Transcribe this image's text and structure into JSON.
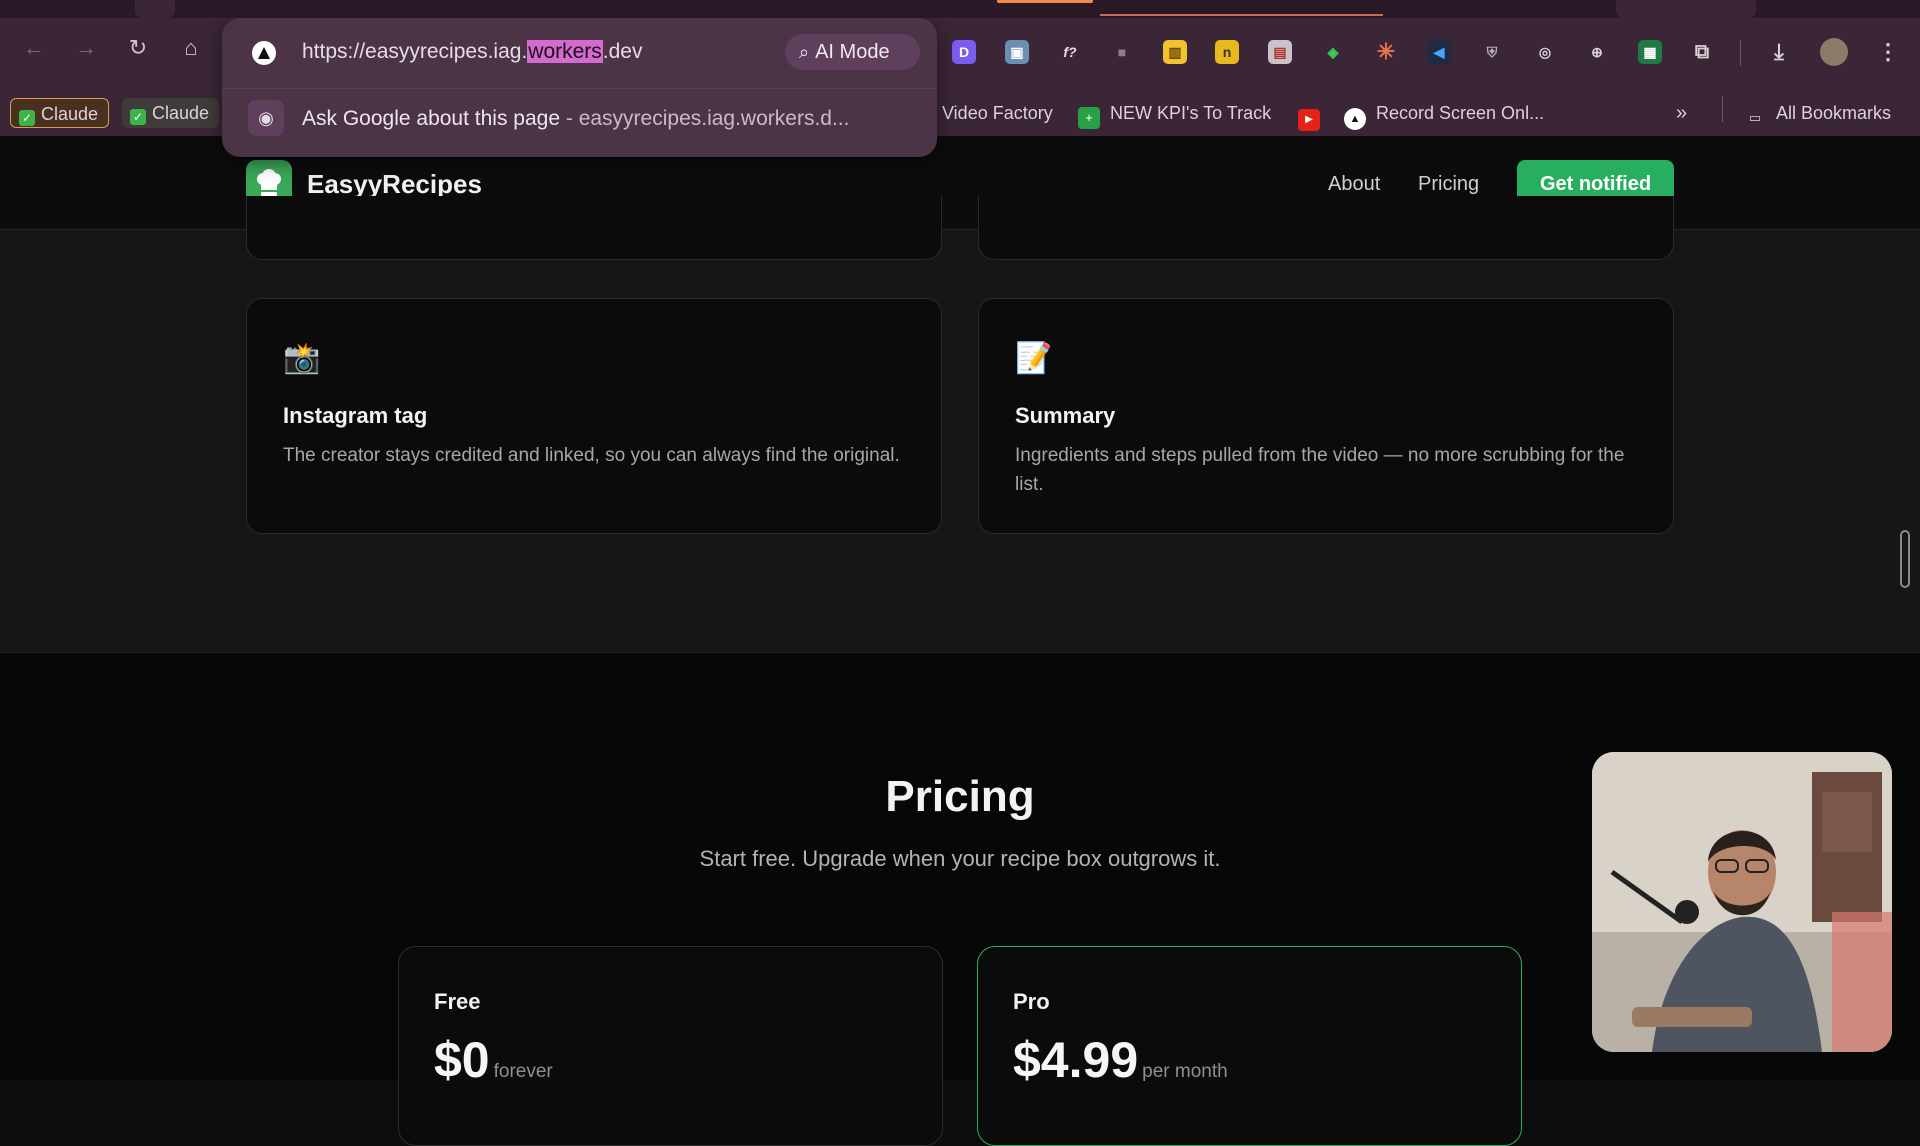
{
  "browser": {
    "url_prefix": "https://easyyrecipes.iag.",
    "url_highlight": "workers",
    "url_suffix": ".dev",
    "ai_mode_label": "AI Mode",
    "suggestion_text": "Ask Google about this page",
    "suggestion_sep": " - ",
    "suggestion_sub": "easyyrecipes.iag.workers.d...",
    "bookmarks": [
      {
        "label": "Claude"
      },
      {
        "label": "Claude"
      },
      {
        "label": "Video Factory"
      },
      {
        "label": "NEW KPI's To Track"
      },
      {
        "label": "Record Screen Onl..."
      },
      {
        "label": "All Bookmarks"
      }
    ],
    "overflow_label": "»"
  },
  "site": {
    "brand": "EasyyRecipes",
    "nav": {
      "about": "About",
      "pricing": "Pricing",
      "cta": "Get notified"
    },
    "features": [
      {
        "icon": "📸",
        "title": "Instagram tag",
        "desc": "The creator stays credited and linked, so you can always find the original."
      },
      {
        "icon": "📝",
        "title": "Summary",
        "desc": "Ingredients and steps pulled from the video — no more scrubbing for the list."
      }
    ],
    "pricing": {
      "title": "Pricing",
      "subtitle": "Start free. Upgrade when your recipe box outgrows it.",
      "plans": [
        {
          "name": "Free",
          "price": "$0",
          "period": "forever"
        },
        {
          "name": "Pro",
          "price": "$4.99",
          "period": "per month"
        }
      ]
    }
  },
  "colors": {
    "accent": "#27ae60",
    "browser_chrome": "#3a2636",
    "highlight": "#d36bd0"
  },
  "icons": [
    "back-arrow-icon",
    "forward-arrow-icon",
    "reload-icon",
    "home-icon",
    "search-sparkle-icon",
    "lens-icon",
    "folder-icon",
    "download-icon",
    "kebab-menu-icon",
    "extensions-icon",
    "chevrons-right-icon"
  ]
}
